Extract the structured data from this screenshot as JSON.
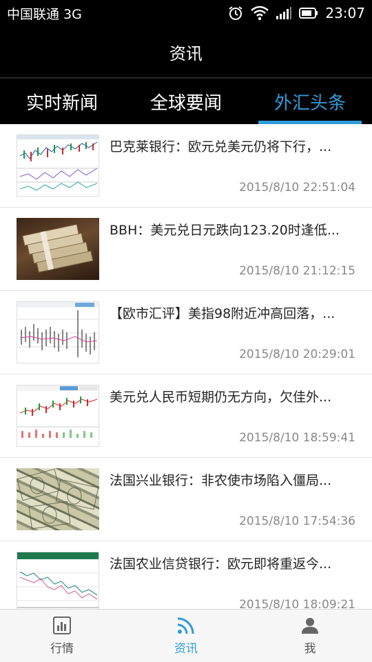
{
  "status_bar": {
    "carrier": "中国联通 3G",
    "time": "23:07",
    "icons": [
      "alarm-icon",
      "wifi-icon",
      "signal-icon",
      "battery-icon"
    ]
  },
  "header": {
    "title": "资讯"
  },
  "tabs": [
    {
      "label": "实时新闻",
      "active": false
    },
    {
      "label": "全球要闻",
      "active": false
    },
    {
      "label": "外汇头条",
      "active": true
    }
  ],
  "news": [
    {
      "title": "巴克莱银行：欧元兑美元仍将下行，...",
      "time": "2015/8/10 22:51:04",
      "thumb": "chart"
    },
    {
      "title": "BBH：美元兑日元跌向123.20时逢低...",
      "time": "2015/8/10 21:12:15",
      "thumb": "cash-stack"
    },
    {
      "title": "【欧市汇评】美指98附近冲高回落，...",
      "time": "2015/8/10 20:29:01",
      "thumb": "chart"
    },
    {
      "title": "美元兑人民币短期仍无方向，欠佳外...",
      "time": "2015/8/10 18:59:41",
      "thumb": "chart"
    },
    {
      "title": "法国兴业银行：非农使市场陷入僵局...",
      "time": "2015/8/10 17:54:36",
      "thumb": "dollars"
    },
    {
      "title": "法国农业信贷银行：欧元即将重返今...",
      "time": "2015/8/10 18:09:21",
      "thumb": "chart"
    }
  ],
  "bottom_nav": [
    {
      "label": "行情",
      "icon": "bar-chart-icon",
      "active": false
    },
    {
      "label": "资讯",
      "icon": "rss-icon",
      "active": true
    },
    {
      "label": "我",
      "icon": "user-icon",
      "active": false
    }
  ],
  "colors": {
    "accent": "#2f9bd9",
    "bar_bg": "#000000",
    "list_bg": "#ffffff"
  }
}
